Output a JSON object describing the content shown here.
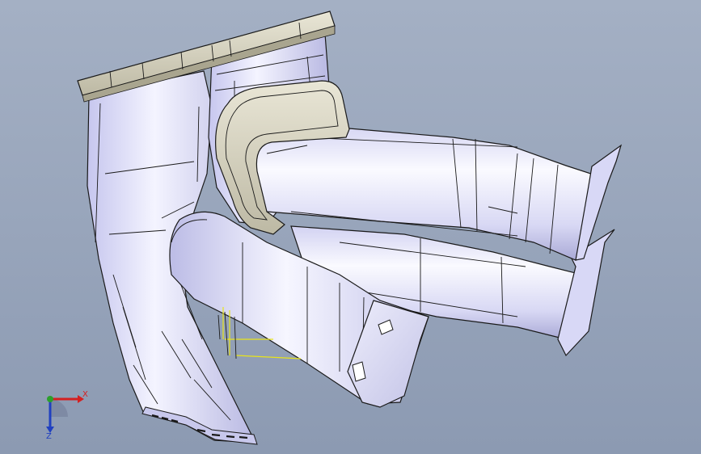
{
  "viewport": {
    "background_top": "#a4b0c4",
    "background_bottom": "#8c9ab2"
  },
  "model": {
    "surface_color": "#e4e4fa",
    "edge_color": "#1a1a1a",
    "flange_color": "#cfcbb8",
    "highlight_color": "#e8e41a"
  },
  "triad": {
    "x_label": "X",
    "z_label": "Z",
    "x_color": "#d42020",
    "y_color": "#2ca02c",
    "z_color": "#2040c0"
  }
}
